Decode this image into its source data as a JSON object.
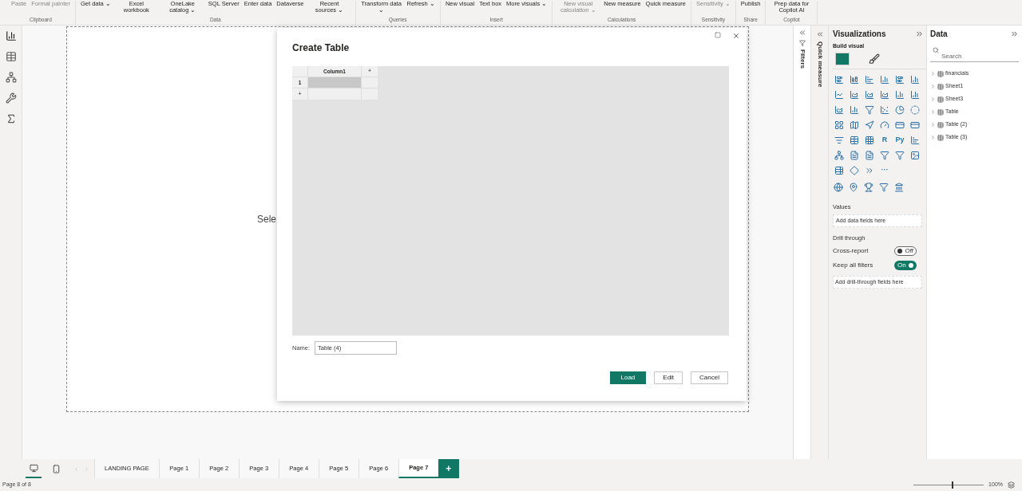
{
  "ribbon": {
    "groups": [
      {
        "label": "Clipboard",
        "buttons": [
          {
            "label": "Paste",
            "disabled": true
          },
          {
            "label": "Format painter",
            "disabled": true
          }
        ]
      },
      {
        "label": "Data",
        "buttons": [
          {
            "label": "Get data ⌄",
            "disabled": false
          },
          {
            "label": "Excel workbook",
            "disabled": false
          },
          {
            "label": "OneLake catalog ⌄",
            "disabled": false
          },
          {
            "label": "SQL Server",
            "disabled": false
          },
          {
            "label": "Enter data",
            "disabled": false
          },
          {
            "label": "Dataverse",
            "disabled": false
          },
          {
            "label": "Recent sources ⌄",
            "disabled": false
          }
        ]
      },
      {
        "label": "Queries",
        "buttons": [
          {
            "label": "Transform data ⌄",
            "disabled": false
          },
          {
            "label": "Refresh ⌄",
            "disabled": false
          }
        ]
      },
      {
        "label": "Insert",
        "buttons": [
          {
            "label": "New visual",
            "disabled": false
          },
          {
            "label": "Text box",
            "disabled": false
          },
          {
            "label": "More visuals ⌄",
            "disabled": false
          }
        ]
      },
      {
        "label": "Calculations",
        "buttons": [
          {
            "label": "New visual calculation ⌄",
            "disabled": true
          },
          {
            "label": "New measure",
            "disabled": false
          },
          {
            "label": "Quick measure",
            "disabled": false
          }
        ]
      },
      {
        "label": "Sensitivity",
        "buttons": [
          {
            "label": "Sensitivity ⌄",
            "disabled": true
          }
        ]
      },
      {
        "label": "Share",
        "buttons": [
          {
            "label": "Publish",
            "disabled": false
          }
        ]
      },
      {
        "label": "Copilot",
        "buttons": [
          {
            "label": "Prep data for Copilot AI",
            "disabled": false
          }
        ]
      }
    ]
  },
  "canvas": {
    "partial_text": "Sele"
  },
  "dialog": {
    "title": "Create Table",
    "column_header": "Column1",
    "add_column": "+",
    "row_number": "1",
    "add_row": "+",
    "name_label": "Name:",
    "name_value": "Table (4)",
    "buttons": [
      {
        "label": "Load",
        "kind": "primary"
      },
      {
        "label": "Edit",
        "kind": "secondary"
      },
      {
        "label": "Cancel",
        "kind": "secondary"
      }
    ]
  },
  "filters_pane": {
    "label": "Filters"
  },
  "visualizations": {
    "title": "Visualizations",
    "quick_measure": "Quick measure",
    "build_visual": "Build visual",
    "text_tiles": [
      "R",
      "Py",
      "···"
    ],
    "values_label": "Values",
    "values_placeholder": "Add data fields here",
    "drill_through": "Drill through",
    "toggles": [
      {
        "label": "Cross-report",
        "on": false,
        "state_text": "Off"
      },
      {
        "label": "Keep all filters",
        "on": true,
        "state_text": "On"
      }
    ],
    "drill_placeholder": "Add drill-through fields here"
  },
  "data_pane": {
    "title": "Data",
    "search_placeholder": "Search",
    "tables": [
      "financials",
      "Sheet1",
      "Sheet3",
      "Table",
      "Table (2)",
      "Table (3)"
    ]
  },
  "pages": [
    {
      "label": "LANDING PAGE",
      "selected": false
    },
    {
      "label": "Page 1",
      "selected": false
    },
    {
      "label": "Page 2",
      "selected": false
    },
    {
      "label": "Page 3",
      "selected": false
    },
    {
      "label": "Page 4",
      "selected": false
    },
    {
      "label": "Page 5",
      "selected": false
    },
    {
      "label": "Page 6",
      "selected": false
    },
    {
      "label": "Page 7",
      "selected": true
    }
  ],
  "add_page": "+",
  "status": {
    "page_info": "Page 8 of 8",
    "zoom_slider": {
      "level": 0.55
    },
    "zoom": "100%"
  }
}
